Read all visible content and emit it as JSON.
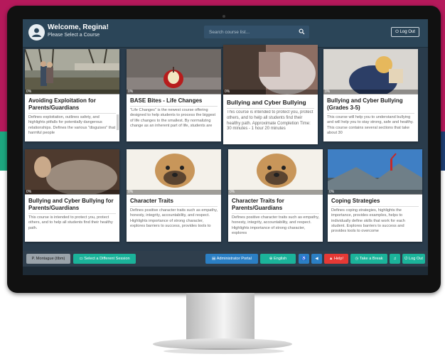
{
  "header": {
    "welcome": "Welcome, Regina!",
    "subtitle": "Please Select a Course",
    "search_placeholder": "Search course list...",
    "logout_label": "Log Out"
  },
  "courses": [
    {
      "title": "Avoiding Exploitation for Parents/Guardians",
      "progress": "0%",
      "description": "Defines exploitation, outlines safety, and highlights pitfalls for potentially dangerous relationships. Defines the various \"disguises\" that harmful people"
    },
    {
      "title": "BASE Bites - Life Changes",
      "progress": "0%",
      "description": "\"Life Changes\" is the newest course offering designed to help students to process the biggest of life changes to the smallest. By normalizing change as an inherent part of life, students are"
    },
    {
      "title": "Bullying and Cyber Bullying",
      "progress": "0%",
      "description": "This course is intended to protect you, protect others, and to help all students find their healthy path. Approximate Completion Time: 30 minutes - 1 hour 20 minutes"
    },
    {
      "title": "Bullying and Cyber Bullying (Grades 3-5)",
      "progress": "0%",
      "description": "This course will help you to understand bullying and will help you to stay strong, safe and healthy. This course contains several sections that take about 30"
    },
    {
      "title": "Bullying and Cyber Bullying for Parents/Guardians",
      "progress": "0%",
      "description": "This course is intended to protect you, protect others, and to help all students find their healthy path."
    },
    {
      "title": "Character Traits",
      "progress": "0%",
      "description": "Defines positive character traits such as empathy, honesty, integrity, accountability, and respect. Highlights importance of strong character, explores barriers to success, provides tools to"
    },
    {
      "title": "Character Traits for Parents/Guardians",
      "progress": "0%",
      "description": "Defines positive character traits such as empathy, honesty, integrity, accountability, and respect. Highlights importance of strong character, explores"
    },
    {
      "title": "Coping Strategies",
      "progress": "0%",
      "description": "Defines coping strategies, highlights the importance, provides examples, helps to individually define skills that work for each student. Explores barriers to success and provides tools to overcome"
    }
  ],
  "footer": {
    "user": "P. Montague (tlbm)",
    "session": "Select a Different Session",
    "admin": "Administrator Portal",
    "language": "English",
    "help": "Help!",
    "take_break": "Take a Break",
    "logout": "Log Out"
  },
  "colors": {
    "magenta_band": "#b5195b",
    "teal": "#1bb39a",
    "blue": "#2b7fc4",
    "help_red": "#e53935",
    "topbar": "#2b4558"
  },
  "icons": [
    "user-avatar-icon",
    "search-icon",
    "power-icon",
    "monitor-icon",
    "document-icon",
    "globe-icon",
    "accessibility-icon",
    "speaker-icon",
    "warning-icon",
    "clock-icon",
    "music-icon"
  ]
}
